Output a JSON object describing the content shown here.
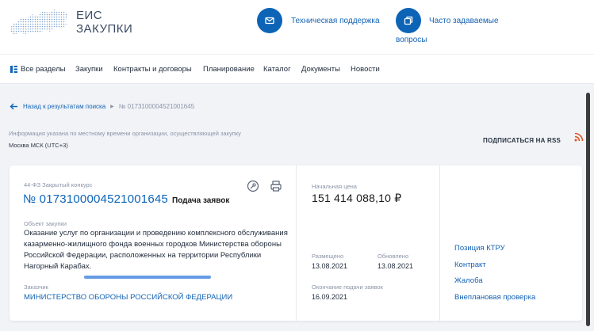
{
  "header": {
    "logo_line1": "ЕИС",
    "logo_line2": "ЗАКУПКИ",
    "support_label": "Техническая поддержка",
    "faq_label_1": "Часто задаваемые",
    "faq_label_2": "вопросы"
  },
  "nav": {
    "items": [
      "Все разделы",
      "Закупки",
      "Контракты и договоры",
      "Планирование",
      "Каталог",
      "Документы",
      "Новости"
    ]
  },
  "breadcrumb": {
    "back_label": "Назад к результатам поиска",
    "current": "№ 0173100004521001645"
  },
  "info": {
    "note": "Информация указана по местному времени организации, осуществляющей закупку",
    "timezone": "Москва МСК (UTC+3)",
    "rss_label": "ПОДПИСАТЬСЯ НА RSS"
  },
  "tender": {
    "law_type": "44-ФЗ Закрытый конкурс",
    "number": "№ 0173100004521001645",
    "stage": "Подача заявок",
    "object_label": "Объект закупки",
    "object_text": "Оказание услуг по организации и проведению комплексного обслуживания казарменно-жилищного фонда военных городков Министерства обороны Российской Федерации, расположенных на территории Республики Нагорный Карабах.",
    "customer_label": "Заказчик",
    "customer_name": "МИНИСТЕРСТВО ОБОРОНЫ РОССИЙСКОЙ ФЕДЕРАЦИИ"
  },
  "price": {
    "label": "Начальная цена",
    "value": "151 414 088,10 ₽"
  },
  "dates": {
    "posted_label": "Размещено",
    "posted_value": "13.08.2021",
    "updated_label": "Обновлено",
    "updated_value": "13.08.2021",
    "deadline_label": "Окончание подачи заявок",
    "deadline_value": "16.09.2021"
  },
  "side_links": [
    "Позиция КТРУ",
    "Контракт",
    "Жалоба",
    "Внеплановая проверка"
  ],
  "colors": {
    "accent": "#0d64b7",
    "link": "#1463b4",
    "muted": "#8a94a6",
    "background": "#f1f3f7",
    "rss": "#e0531f"
  }
}
